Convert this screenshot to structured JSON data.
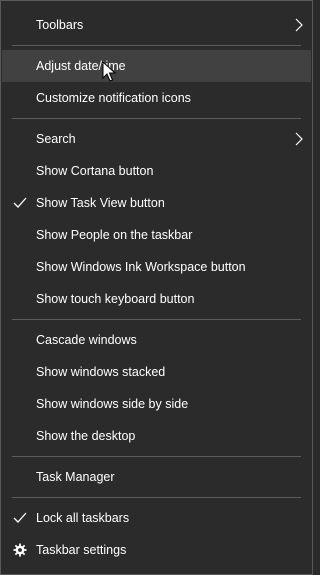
{
  "menu": {
    "items": [
      {
        "label": "Toolbars"
      },
      {
        "label": "Adjust date/time"
      },
      {
        "label": "Customize notification icons"
      },
      {
        "label": "Search"
      },
      {
        "label": "Show Cortana button"
      },
      {
        "label": "Show Task View button"
      },
      {
        "label": "Show People on the taskbar"
      },
      {
        "label": "Show Windows Ink Workspace button"
      },
      {
        "label": "Show touch keyboard button"
      },
      {
        "label": "Cascade windows"
      },
      {
        "label": "Show windows stacked"
      },
      {
        "label": "Show windows side by side"
      },
      {
        "label": "Show the desktop"
      },
      {
        "label": "Task Manager"
      },
      {
        "label": "Lock all taskbars"
      },
      {
        "label": "Taskbar settings"
      }
    ]
  },
  "colors": {
    "background": "#2b2b2b",
    "highlight": "#414141",
    "separator": "#5d5d5d",
    "text": "#ffffff"
  },
  "icons": {
    "submenu": "chevron-right-icon",
    "checked": "checkmark-icon",
    "settings": "gear-icon",
    "pointer": "mouse-cursor-icon"
  }
}
